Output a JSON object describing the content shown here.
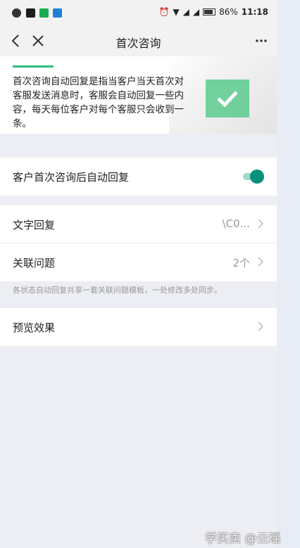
{
  "status_bar": {
    "battery": "86%",
    "time": "11:18",
    "icons": [
      "app-icon-dark",
      "app-icon-terminal",
      "app-icon-green",
      "app-icon-blue",
      "alarm-icon",
      "wifi-icon",
      "signal-icon",
      "signal-icon",
      "battery-icon"
    ]
  },
  "nav": {
    "title": "首次咨询",
    "icons": [
      "back-icon",
      "close-icon",
      "more-icon"
    ]
  },
  "banner": {
    "text": "首次咨询自动回复是指当客户当天首次对客服发送消息时，客服会自动回复一些内容，每天每位客户对每个客服只会收到一条。",
    "accent_color": "#2ec07a"
  },
  "auto_reply": {
    "label": "客户首次咨询后自动回复",
    "enabled": true,
    "toggle_color": "#06917a"
  },
  "settings": {
    "text_reply": {
      "label": "文字回复",
      "value": "\\C0..."
    },
    "related_questions": {
      "label": "关联问题",
      "value": "2个"
    },
    "hint": "各状态自动回复共享一套关联问题模板，一处修改多处同步。",
    "preview": {
      "label": "预览效果"
    }
  },
  "watermark": "学买卖 @云瑶"
}
